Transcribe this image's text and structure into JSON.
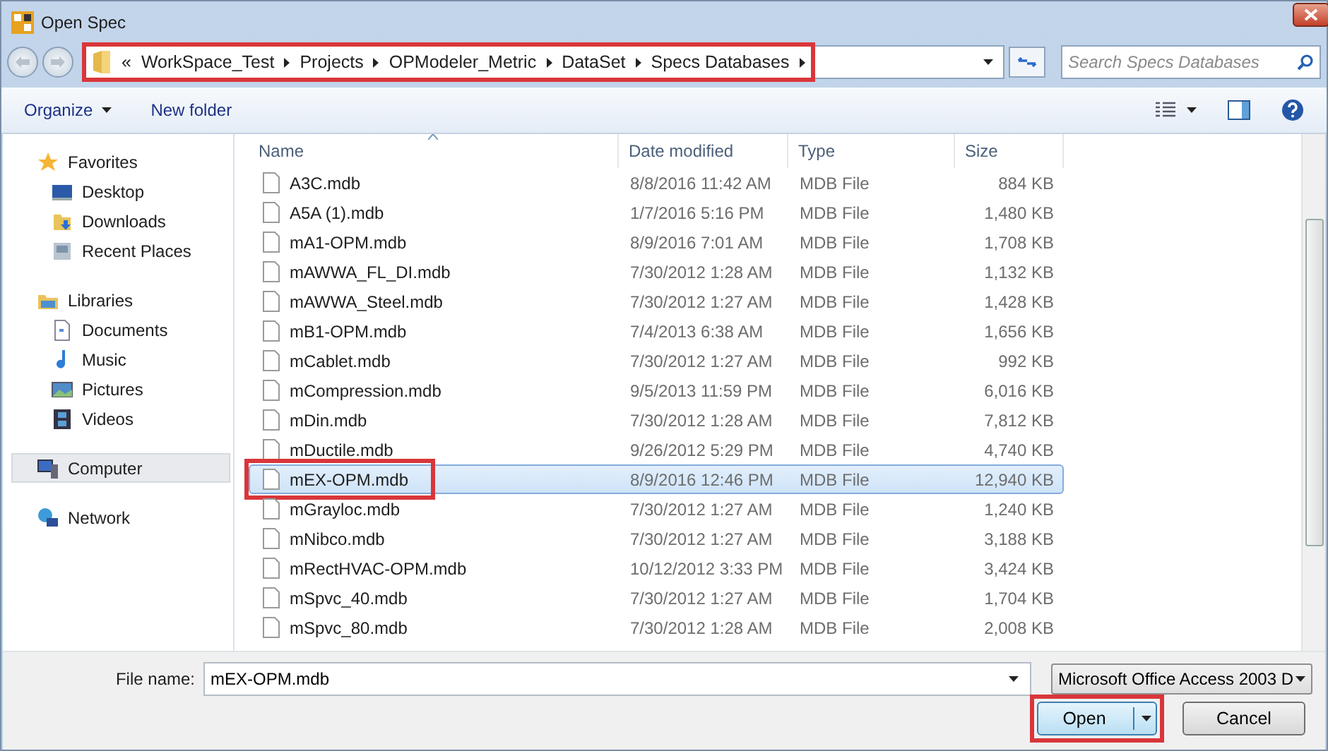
{
  "window": {
    "title": "Open Spec"
  },
  "address_bar": {
    "overflow_marker": "«",
    "crumbs": [
      "WorkSpace_Test",
      "Projects",
      "OPModeler_Metric",
      "DataSet",
      "Specs Databases"
    ],
    "highlighted": true
  },
  "search": {
    "placeholder": "Search Specs Databases"
  },
  "toolbar": {
    "buttons": [
      {
        "label": "Organize",
        "has_menu": true
      },
      {
        "label": "New folder",
        "has_menu": false
      }
    ]
  },
  "sidebar": {
    "groups": [
      {
        "label": "Favorites",
        "selected": false,
        "items": [
          {
            "label": "Desktop",
            "selected": false
          },
          {
            "label": "Downloads",
            "selected": false
          },
          {
            "label": "Recent Places",
            "selected": false
          }
        ]
      },
      {
        "label": "Libraries",
        "selected": false,
        "items": [
          {
            "label": "Documents",
            "selected": false
          },
          {
            "label": "Music",
            "selected": false
          },
          {
            "label": "Pictures",
            "selected": false
          },
          {
            "label": "Videos",
            "selected": false
          }
        ]
      },
      {
        "label": "Computer",
        "selected": true
      },
      {
        "label": "Network",
        "selected": false
      }
    ]
  },
  "file_list": {
    "columns": [
      "Name",
      "Date modified",
      "Type",
      "Size"
    ],
    "rows": [
      {
        "name": "A3C.mdb",
        "date": "8/8/2016 11:42 AM",
        "type": "MDB File",
        "size": "884 KB",
        "selected": false,
        "highlighted": false
      },
      {
        "name": "A5A (1).mdb",
        "date": "1/7/2016 5:16 PM",
        "type": "MDB File",
        "size": "1,480 KB",
        "selected": false,
        "highlighted": false
      },
      {
        "name": "mA1-OPM.mdb",
        "date": "8/9/2016 7:01 AM",
        "type": "MDB File",
        "size": "1,708 KB",
        "selected": false,
        "highlighted": false
      },
      {
        "name": "mAWWA_FL_DI.mdb",
        "date": "7/30/2012 1:28 AM",
        "type": "MDB File",
        "size": "1,132 KB",
        "selected": false,
        "highlighted": false
      },
      {
        "name": "mAWWA_Steel.mdb",
        "date": "7/30/2012 1:27 AM",
        "type": "MDB File",
        "size": "1,428 KB",
        "selected": false,
        "highlighted": false
      },
      {
        "name": "mB1-OPM.mdb",
        "date": "7/4/2013 6:38 AM",
        "type": "MDB File",
        "size": "1,656 KB",
        "selected": false,
        "highlighted": false
      },
      {
        "name": "mCablet.mdb",
        "date": "7/30/2012 1:27 AM",
        "type": "MDB File",
        "size": "992 KB",
        "selected": false,
        "highlighted": false
      },
      {
        "name": "mCompression.mdb",
        "date": "9/5/2013 11:59 PM",
        "type": "MDB File",
        "size": "6,016 KB",
        "selected": false,
        "highlighted": false
      },
      {
        "name": "mDin.mdb",
        "date": "7/30/2012 1:28 AM",
        "type": "MDB File",
        "size": "7,812 KB",
        "selected": false,
        "highlighted": false
      },
      {
        "name": "mDuctile.mdb",
        "date": "9/26/2012 5:29 PM",
        "type": "MDB File",
        "size": "4,740 KB",
        "selected": false,
        "highlighted": false
      },
      {
        "name": "mEX-OPM.mdb",
        "date": "8/9/2016 12:46 PM",
        "type": "MDB File",
        "size": "12,940 KB",
        "selected": true,
        "highlighted": true
      },
      {
        "name": "mGrayloc.mdb",
        "date": "7/30/2012 1:27 AM",
        "type": "MDB File",
        "size": "1,240 KB",
        "selected": false,
        "highlighted": false
      },
      {
        "name": "mNibco.mdb",
        "date": "7/30/2012 1:27 AM",
        "type": "MDB File",
        "size": "3,188 KB",
        "selected": false,
        "highlighted": false
      },
      {
        "name": "mRectHVAC-OPM.mdb",
        "date": "10/12/2012 3:33 PM",
        "type": "MDB File",
        "size": "3,424 KB",
        "selected": false,
        "highlighted": false
      },
      {
        "name": "mSpvc_40.mdb",
        "date": "7/30/2012 1:27 AM",
        "type": "MDB File",
        "size": "1,704 KB",
        "selected": false,
        "highlighted": false
      },
      {
        "name": "mSpvc_80.mdb",
        "date": "7/30/2012 1:28 AM",
        "type": "MDB File",
        "size": "2,008 KB",
        "selected": false,
        "highlighted": false
      }
    ]
  },
  "file_name": {
    "label": "File name:",
    "value": "mEX-OPM.mdb"
  },
  "file_type": {
    "value": "Microsoft Office Access 2003 D"
  },
  "buttons": [
    {
      "label": "Open",
      "kind": "split",
      "highlighted": true
    },
    {
      "label": "Cancel",
      "kind": "plain",
      "highlighted": false
    }
  ]
}
